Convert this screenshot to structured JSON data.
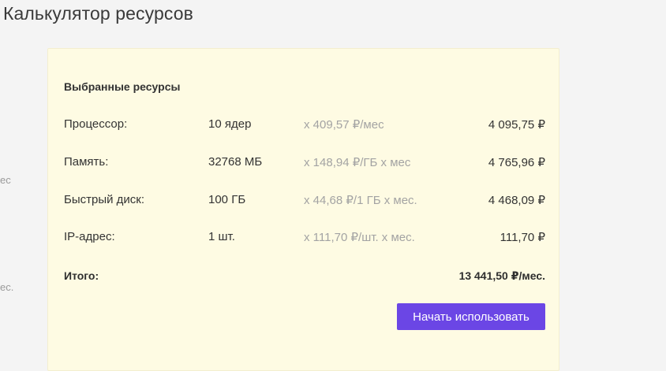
{
  "page": {
    "title": "Калькулятор ресурсов",
    "side_fragments": [
      "ес",
      "ес."
    ]
  },
  "card": {
    "heading": "Выбранные ресурсы",
    "rows": [
      {
        "label": "Процессор:",
        "quantity": "10 ядер",
        "rate": "x 409,57 ₽/мес",
        "sum": "4 095,75 ₽"
      },
      {
        "label": "Память:",
        "quantity": "32768 МБ",
        "rate": "x 148,94 ₽/ГБ x мес",
        "sum": "4 765,96 ₽"
      },
      {
        "label": "Быстрый диск:",
        "quantity": "100 ГБ",
        "rate": "x 44,68 ₽/1 ГБ x мес.",
        "sum": "4 468,09 ₽"
      },
      {
        "label": "IP-адрес:",
        "quantity": "1 шт.",
        "rate": "x 111,70 ₽/шт. x мес.",
        "sum": "111,70 ₽"
      }
    ],
    "total": {
      "label": "Итого:",
      "sum": "13 441,50 ₽/мес."
    },
    "start_button_label": "Начать использовать"
  },
  "colors": {
    "card_background": "#fefbe3",
    "accent": "#6b46e5",
    "muted_text": "#a3a3a3",
    "page_background": "#f4f4f4"
  }
}
